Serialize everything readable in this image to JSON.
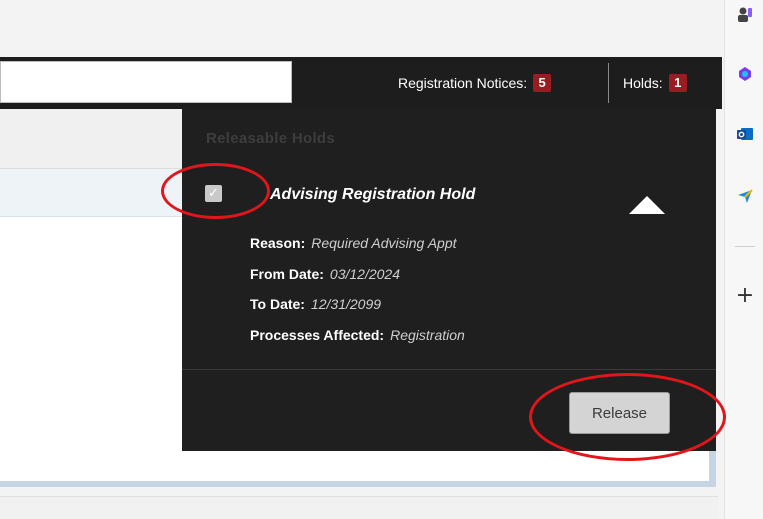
{
  "header": {
    "search_value": "",
    "registration_notices_label": "Registration Notices:",
    "registration_notices_count": "5",
    "holds_label": "Holds:",
    "holds_count": "1"
  },
  "holds_popup": {
    "title": "Releasable Holds",
    "hold": {
      "checked": true,
      "check_glyph": "✓",
      "title": "Advising Registration Hold",
      "details": [
        {
          "label": "Reason:",
          "value": "Required Advising Appt"
        },
        {
          "label": "From Date:",
          "value": "03/12/2024"
        },
        {
          "label": "To Date:",
          "value": "12/31/2099"
        },
        {
          "label": "Processes Affected:",
          "value": "Registration"
        }
      ]
    },
    "release_label": "Release"
  },
  "browser_sidebar": {
    "icons": [
      "profile-icon",
      "copilot-icon",
      "outlook-icon",
      "send-icon"
    ],
    "add_glyph": "+"
  },
  "colors": {
    "header_bg": "#1d1d1d",
    "badge": "#9b1b22",
    "popup_bg": "#1f1f1f",
    "annotation": "#e0161b"
  }
}
